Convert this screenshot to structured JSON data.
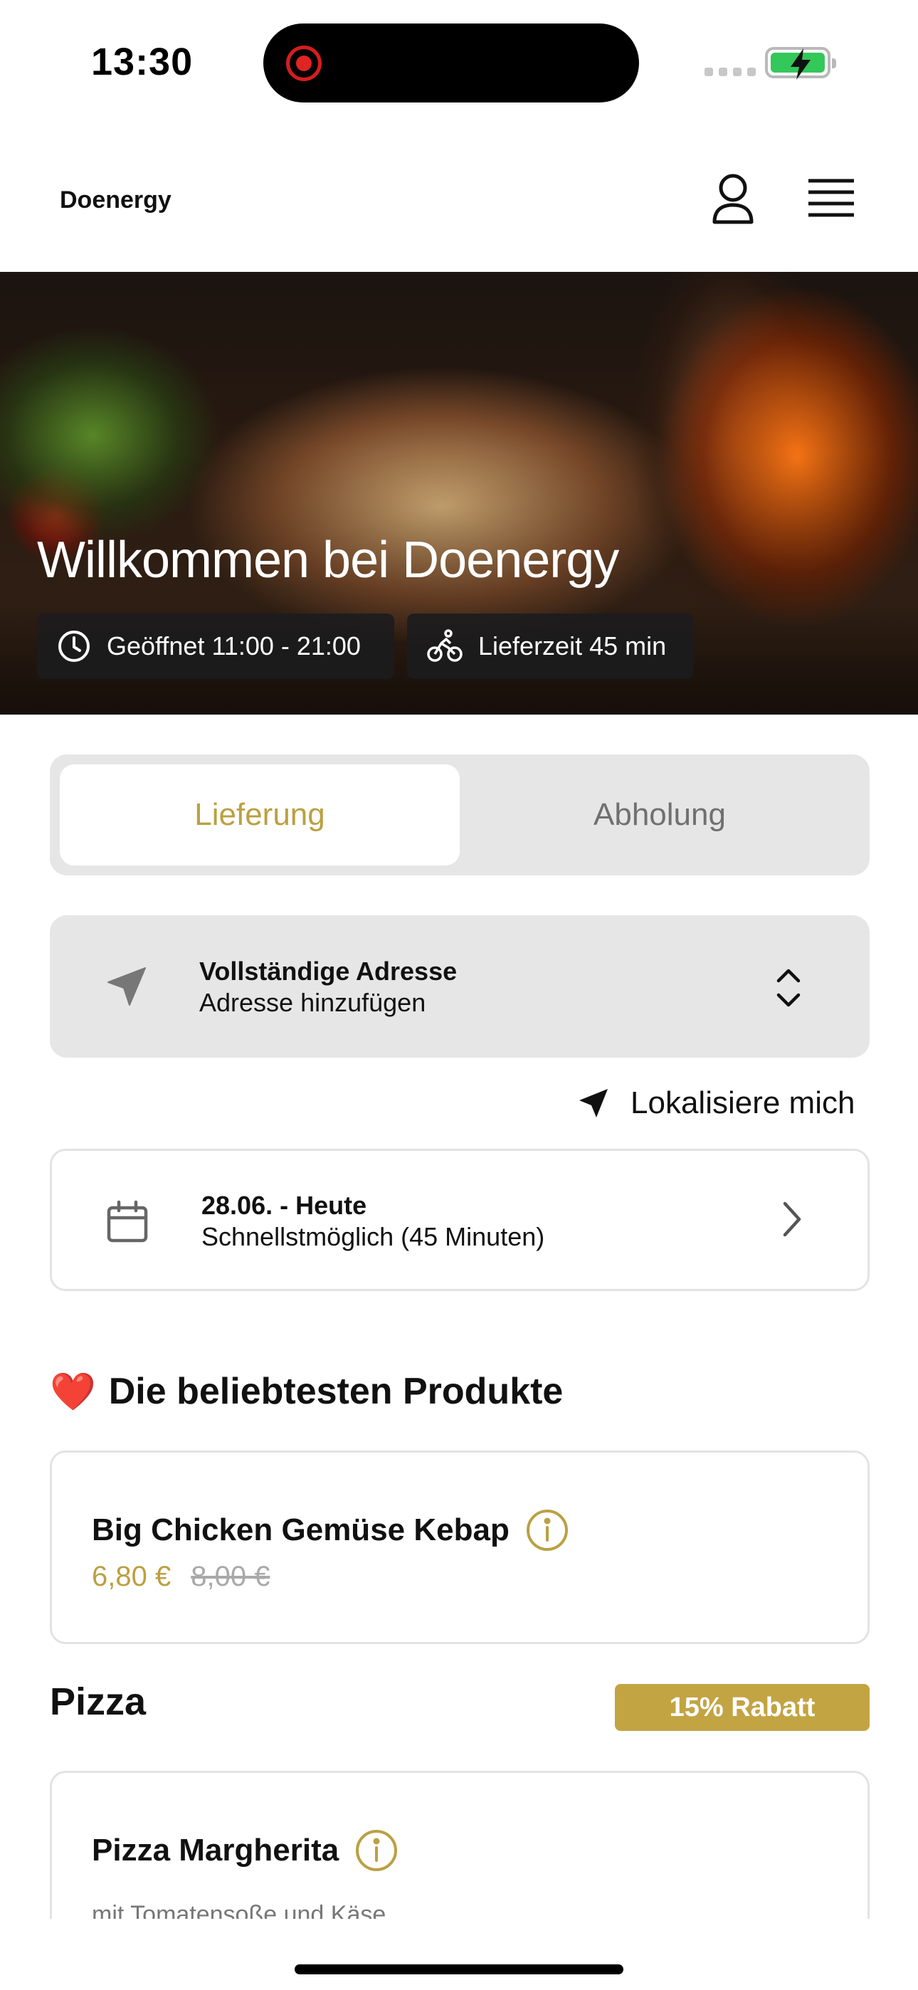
{
  "status_bar": {
    "time": "13:30",
    "colors": {
      "recording": "#e02424",
      "battery": "#34c759"
    }
  },
  "header": {
    "brand": "Doenergy",
    "icons": {
      "account": "person-outline-icon",
      "menu": "hamburger-menu-icon"
    }
  },
  "hero": {
    "title": "Willkommen bei Doenergy",
    "opening_hours": "Geöffnet 11:00 - 21:00",
    "delivery_time": "Lieferzeit 45 min",
    "icons": {
      "hours": "clock-icon",
      "delivery": "bicycle-icon"
    }
  },
  "order_mode": {
    "options": [
      "Lieferung",
      "Abholung"
    ],
    "selected": "Lieferung",
    "accent_color": "#bba043"
  },
  "address": {
    "title": "Vollständige Adresse",
    "placeholder": "Adresse hinzufügen",
    "locate_label": "Lokalisiere mich",
    "icons": {
      "address": "navigation-arrow-icon",
      "expand": "chevron-up-down-icon",
      "locate": "location-arrow-icon"
    }
  },
  "schedule": {
    "date": "28.06. - Heute",
    "time": "Schnellstmöglich (45 Minuten)",
    "icons": {
      "calendar": "calendar-icon",
      "open": "chevron-right-icon"
    }
  },
  "popular": {
    "emoji": "❤️",
    "heading": "Die beliebtesten Produkte",
    "products": [
      {
        "name": "Big Chicken Gemüse Kebap",
        "price": "6,80 €",
        "old_price": "8,00 €"
      }
    ]
  },
  "pizza": {
    "heading": "Pizza",
    "discount": "15% Rabatt",
    "discount_color": "#c2a443",
    "products": [
      {
        "name": "Pizza Margherita",
        "description": "mit Tomatensoße und Käse"
      }
    ]
  }
}
